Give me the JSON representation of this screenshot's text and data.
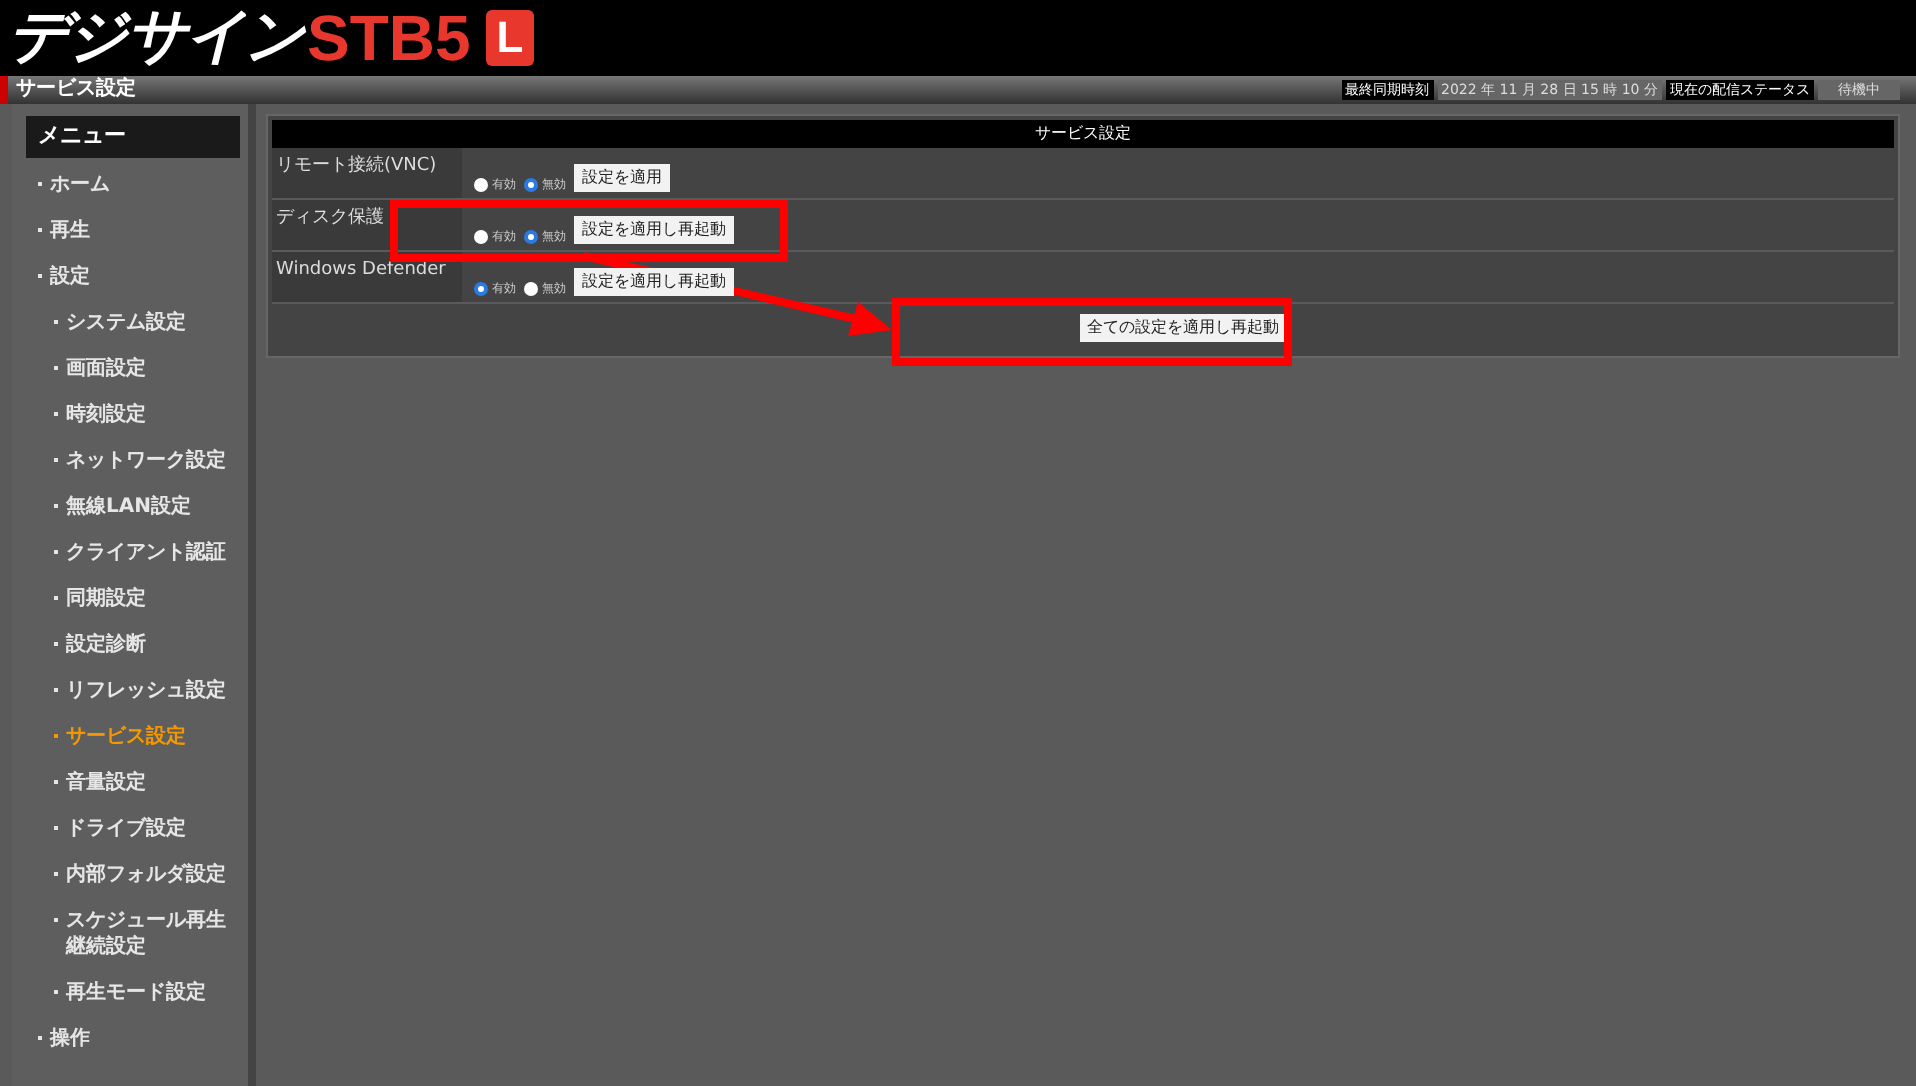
{
  "logo": {
    "name": "デジサイン",
    "model": "STB5",
    "badge": "L"
  },
  "title_bar": {
    "title": "サービス設定",
    "status": [
      {
        "kind": "label",
        "text": "最終同期時刻"
      },
      {
        "kind": "value",
        "text": "2022 年 11 月 28 日 15 時 10 分"
      },
      {
        "kind": "label",
        "text": "現在の配信ステータス"
      },
      {
        "kind": "value",
        "text": "待機中"
      }
    ]
  },
  "sidebar": {
    "heading": "メニュー",
    "items": [
      {
        "label": "ホーム",
        "selected": false
      },
      {
        "label": "再生",
        "selected": false
      },
      {
        "label": "設定",
        "selected": false,
        "children": [
          {
            "label": "システム設定",
            "selected": false
          },
          {
            "label": "画面設定",
            "selected": false
          },
          {
            "label": "時刻設定",
            "selected": false
          },
          {
            "label": "ネットワーク設定",
            "selected": false
          },
          {
            "label": "無線LAN設定",
            "selected": false
          },
          {
            "label": "クライアント認証",
            "selected": false
          },
          {
            "label": "同期設定",
            "selected": false
          },
          {
            "label": "設定診断",
            "selected": false
          },
          {
            "label": "リフレッシュ設定",
            "selected": false
          },
          {
            "label": "サービス設定",
            "selected": true
          },
          {
            "label": "音量設定",
            "selected": false
          },
          {
            "label": "ドライブ設定",
            "selected": false
          },
          {
            "label": "内部フォルダ設定",
            "selected": false
          },
          {
            "label": "スケジュール再生継続設定",
            "selected": false
          },
          {
            "label": "再生モード設定",
            "selected": false
          }
        ]
      },
      {
        "label": "操作",
        "selected": false
      }
    ]
  },
  "panel": {
    "title": "サービス設定",
    "rows": [
      {
        "label": "リモート接続(VNC)",
        "options": [
          {
            "label": "有効",
            "selected": false
          },
          {
            "label": "無効",
            "selected": true
          }
        ],
        "button": "設定を適用"
      },
      {
        "label": "ディスク保護",
        "options": [
          {
            "label": "有効",
            "selected": false
          },
          {
            "label": "無効",
            "selected": true
          }
        ],
        "button": "設定を適用し再起動"
      },
      {
        "label": "Windows Defender",
        "options": [
          {
            "label": "有効",
            "selected": true
          },
          {
            "label": "無効",
            "selected": false
          }
        ],
        "button": "設定を適用し再起動"
      }
    ],
    "footer_button": "全ての設定を適用し再起動"
  }
}
